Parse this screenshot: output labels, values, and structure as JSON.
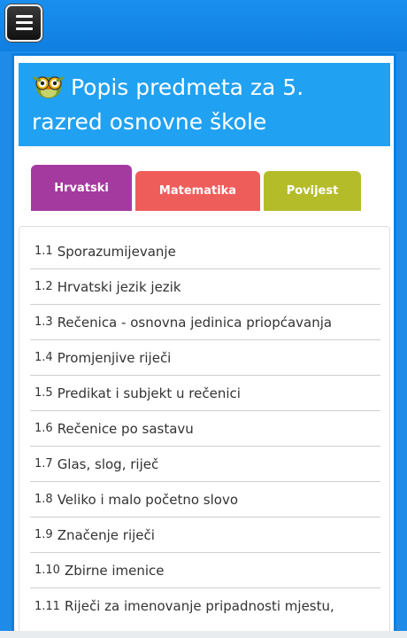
{
  "header": {
    "title": "Popis predmeta za 5. razred osnovne škole",
    "icon": "owl-icon"
  },
  "menu": {
    "icon": "hamburger-menu-icon"
  },
  "tabs": [
    {
      "label": "Hrvatski",
      "color": "#a43a9f"
    },
    {
      "label": "Matematika",
      "color": "#ef5d5b"
    },
    {
      "label": "Povijest",
      "color": "#b5bc2a"
    }
  ],
  "lessons": [
    {
      "num": "1.1",
      "label": "Sporazumijevanje"
    },
    {
      "num": "1.2",
      "label": "Hrvatski jezik jezik"
    },
    {
      "num": "1.3",
      "label": "Rečenica - osnovna jedinica priopćavanja"
    },
    {
      "num": "1.4",
      "label": "Promjenjive riječi"
    },
    {
      "num": "1.5",
      "label": "Predikat i subjekt u rečenici"
    },
    {
      "num": "1.6",
      "label": "Rečenice po sastavu"
    },
    {
      "num": "1.7",
      "label": "Glas, slog, riječ"
    },
    {
      "num": "1.8",
      "label": "Veliko i malo početno slovo"
    },
    {
      "num": "1.9",
      "label": "Značenje riječi"
    },
    {
      "num": "1.10",
      "label": "Zbirne imenice"
    },
    {
      "num": "1.11",
      "label": "Riječi za imenovanje pripadnosti mjestu,"
    }
  ],
  "colors": {
    "topbar": "#1a8ff0",
    "header": "#21a1f1"
  }
}
